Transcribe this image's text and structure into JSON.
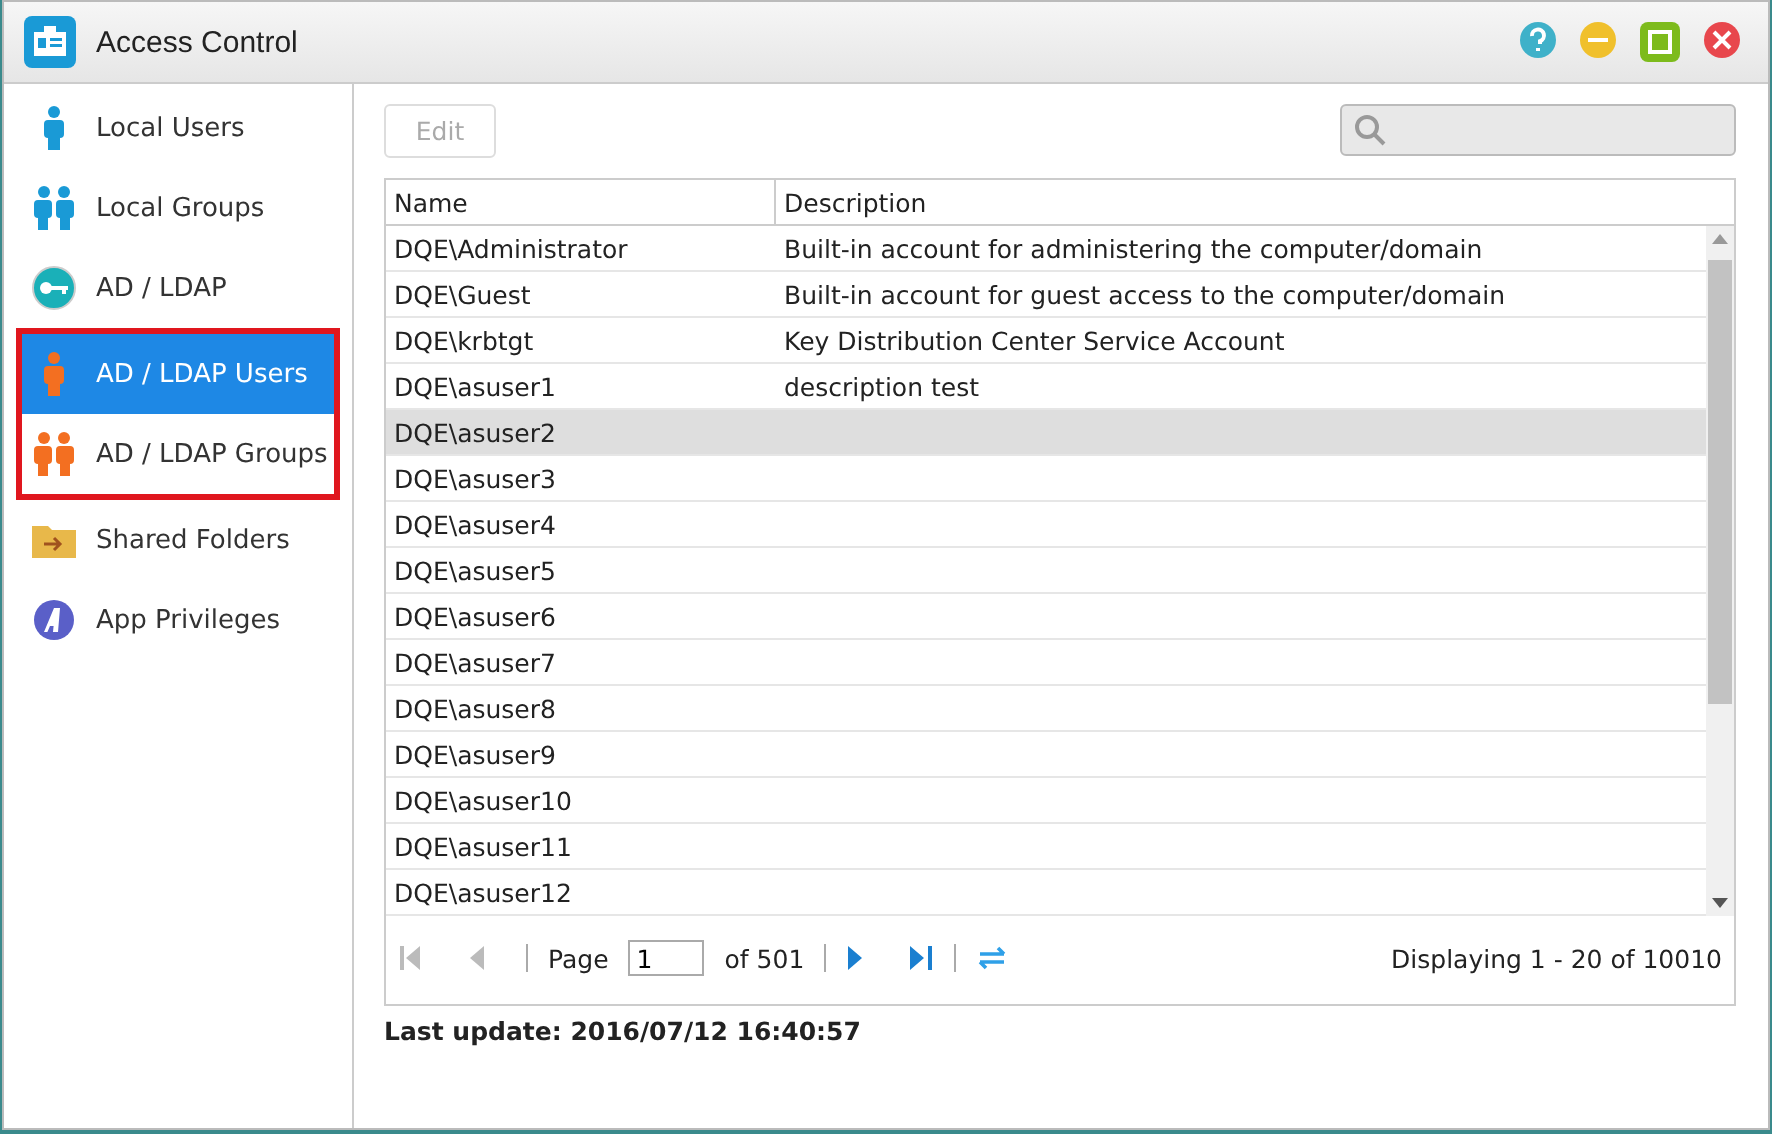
{
  "window": {
    "title": "Access Control"
  },
  "sidebar": {
    "items": [
      {
        "label": "Local Users",
        "kind": "user",
        "selected": false,
        "highlighted": false
      },
      {
        "label": "Local Groups",
        "kind": "group",
        "selected": false,
        "highlighted": false
      },
      {
        "label": "AD / LDAP",
        "kind": "key",
        "selected": false,
        "highlighted": false
      },
      {
        "label": "AD / LDAP Users",
        "kind": "user-orange",
        "selected": true,
        "highlighted": true
      },
      {
        "label": "AD / LDAP Groups",
        "kind": "group-orange",
        "selected": false,
        "highlighted": true
      },
      {
        "label": "Shared Folders",
        "kind": "folder",
        "selected": false,
        "highlighted": false
      },
      {
        "label": "App Privileges",
        "kind": "app",
        "selected": false,
        "highlighted": false
      }
    ]
  },
  "toolbar": {
    "edit_button": {
      "label": "Edit",
      "disabled": true
    }
  },
  "table": {
    "columns": [
      "Name",
      "Description"
    ],
    "rows": [
      {
        "name": "DQE\\Administrator",
        "description": "Built-in account for administering the computer/domain",
        "selected": false
      },
      {
        "name": "DQE\\Guest",
        "description": "Built-in account for guest access to the computer/domain",
        "selected": false
      },
      {
        "name": "DQE\\krbtgt",
        "description": "Key Distribution Center Service Account",
        "selected": false
      },
      {
        "name": "DQE\\asuser1",
        "description": "description test",
        "selected": false
      },
      {
        "name": "DQE\\asuser2",
        "selected": true
      },
      {
        "name": "DQE\\asuser3",
        "selected": false
      },
      {
        "name": "DQE\\asuser4",
        "selected": false
      },
      {
        "name": "DQE\\asuser5",
        "selected": false
      },
      {
        "name": "DQE\\asuser6",
        "selected": false
      },
      {
        "name": "DQE\\asuser7",
        "selected": false
      },
      {
        "name": "DQE\\asuser8",
        "selected": false
      },
      {
        "name": "DQE\\asuser9",
        "selected": false
      },
      {
        "name": "DQE\\asuser10",
        "selected": false
      },
      {
        "name": "DQE\\asuser11",
        "selected": false
      },
      {
        "name": "DQE\\asuser12",
        "selected": false
      }
    ]
  },
  "pager": {
    "page_label": "Page",
    "page": "1",
    "of": "of 501",
    "displaying": "Displaying 1 - 20 of 10010"
  },
  "last_update": "Last update: 2016/07/12 16:40:57"
}
